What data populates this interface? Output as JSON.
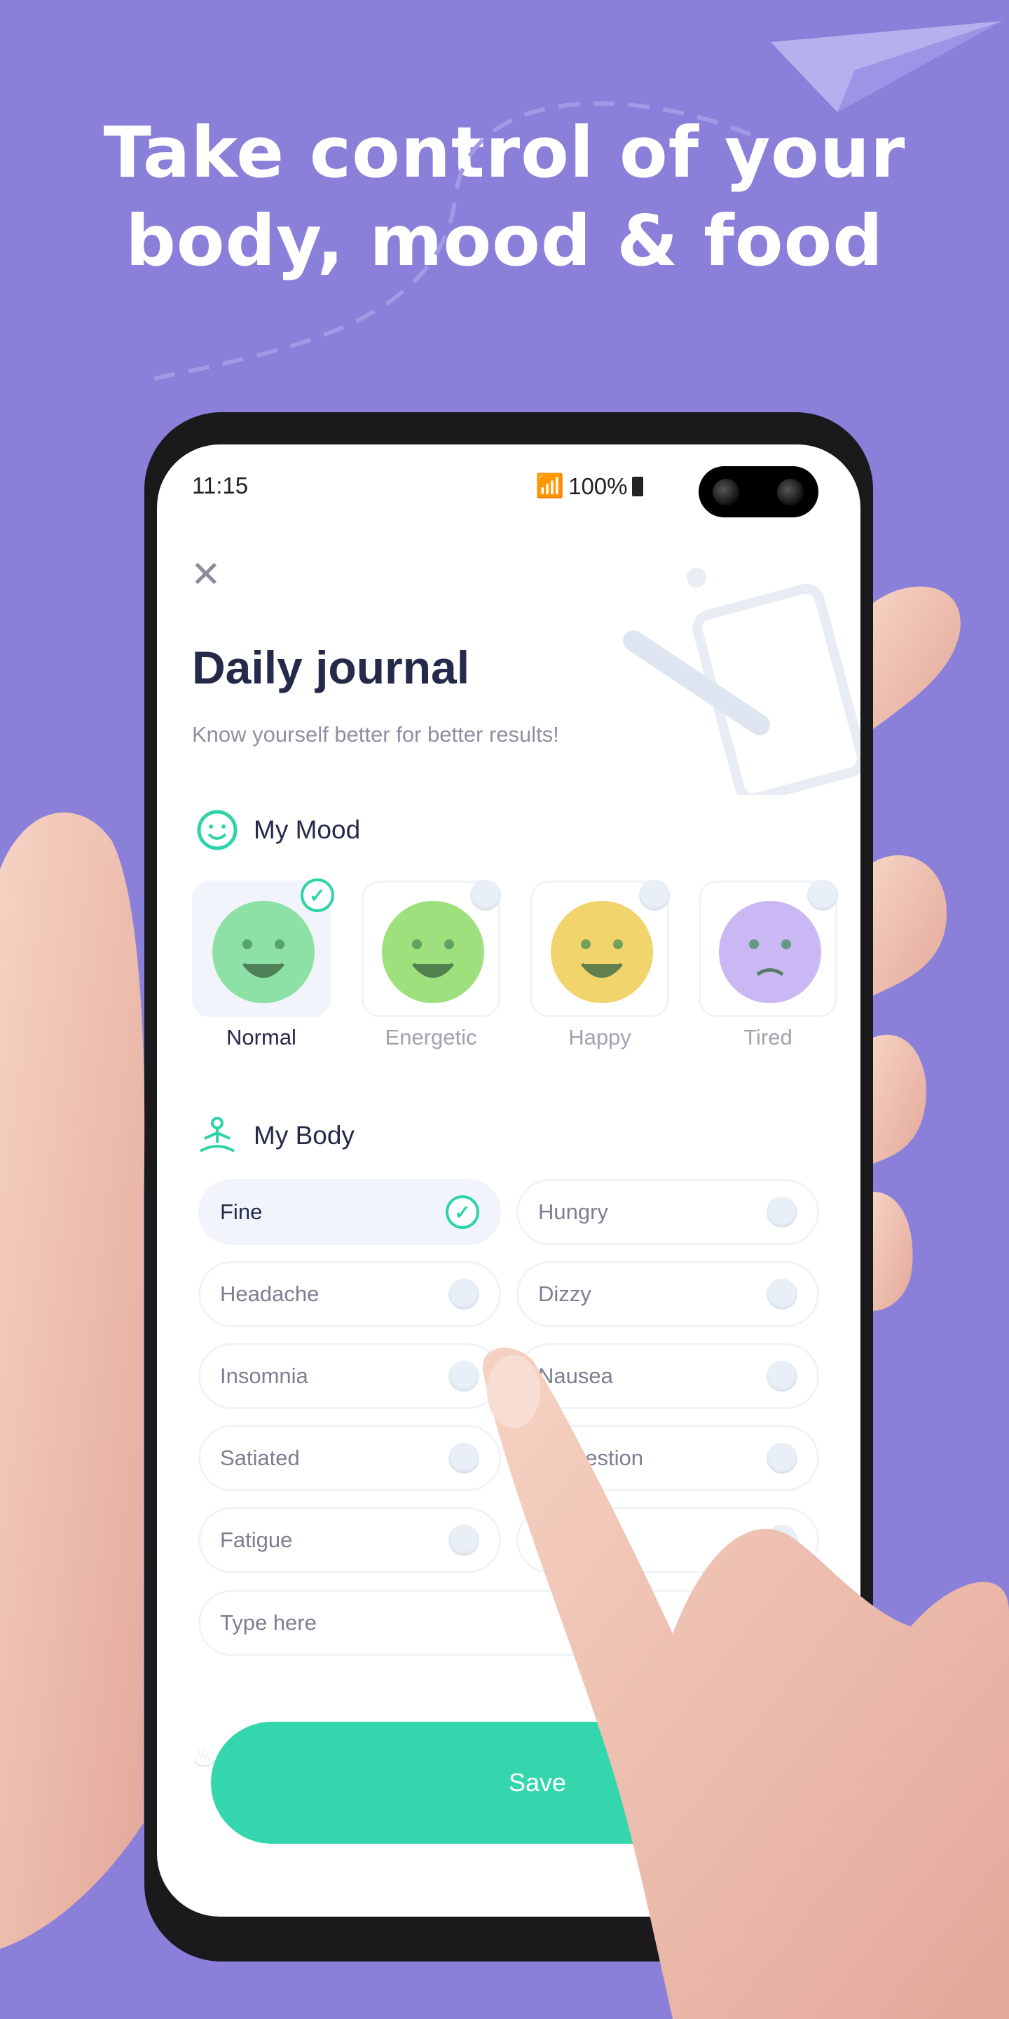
{
  "headline": {
    "line1": "Take control of your",
    "line2": "body, mood & food"
  },
  "status_bar": {
    "time": "11:15",
    "battery": "100%"
  },
  "journal": {
    "title": "Daily journal",
    "subtitle": "Know yourself better for better results!",
    "mood_section": {
      "label": "My Mood",
      "items": [
        {
          "label": "Normal",
          "selected": true,
          "color": "#8de0a6"
        },
        {
          "label": "Energetic",
          "selected": false,
          "color": "#9fe07e"
        },
        {
          "label": "Happy",
          "selected": false,
          "color": "#f2d46c"
        },
        {
          "label": "Tired",
          "selected": false,
          "color": "#c9b8f3"
        }
      ]
    },
    "body_section": {
      "label": "My Body",
      "items": [
        {
          "label": "Fine",
          "selected": true
        },
        {
          "label": "Hungry",
          "selected": false
        },
        {
          "label": "Headache",
          "selected": false
        },
        {
          "label": "Dizzy",
          "selected": false
        },
        {
          "label": "Insomnia",
          "selected": false
        },
        {
          "label": "Nausea",
          "selected": false
        },
        {
          "label": "Satiated",
          "selected": false
        },
        {
          "label": "Indigestion",
          "selected": false
        },
        {
          "label": "Fatigue",
          "selected": false
        },
        {
          "label": "",
          "selected": false
        }
      ],
      "input_placeholder": "Type here"
    },
    "save_label": "Save"
  },
  "colors": {
    "background": "#8a80da",
    "accent": "#33d6ad",
    "title": "#262a4a"
  }
}
